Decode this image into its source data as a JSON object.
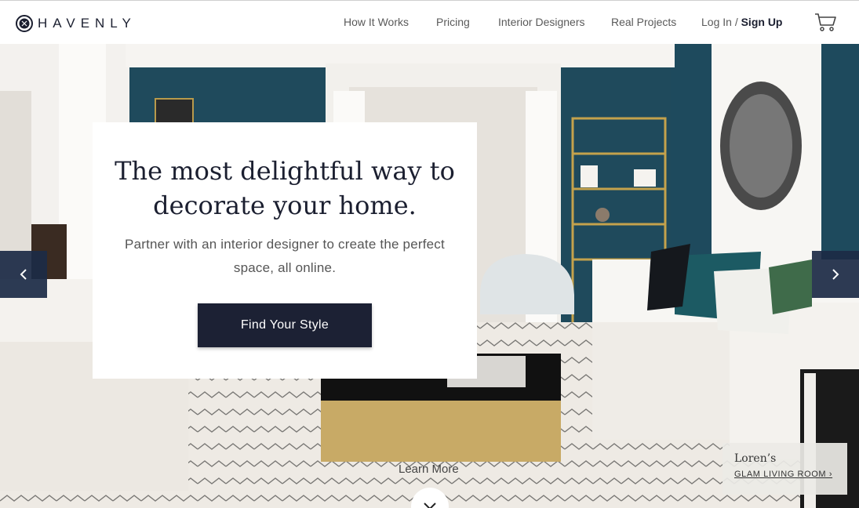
{
  "brand": {
    "name": "HAVENLY",
    "logo_icon": "havenly-logo-icon",
    "color": "#1b1f30"
  },
  "nav": {
    "items": [
      {
        "label": "How It Works"
      },
      {
        "label": "Pricing"
      },
      {
        "label": "Interior Designers"
      },
      {
        "label": "Real Projects"
      }
    ],
    "login_label": "Log In /",
    "signup_label": "Sign Up",
    "cart_icon": "cart-icon"
  },
  "hero": {
    "title": "The most delightful way to decorate your home.",
    "subtitle": "Partner with an interior designer to create the perfect space, all online.",
    "cta_label": "Find Your Style",
    "cta_color": "#1c2134",
    "prev_icon": "chevron-left-icon",
    "next_icon": "chevron-right-icon",
    "learn_more": "Learn More",
    "scroll_icon": "chevron-down-icon",
    "credit": {
      "name": "Loren’s",
      "link": "GLAM LIVING ROOM ›"
    }
  },
  "colors": {
    "arrow_bg": "#1c2b46",
    "wall": "#1f4a5c"
  }
}
